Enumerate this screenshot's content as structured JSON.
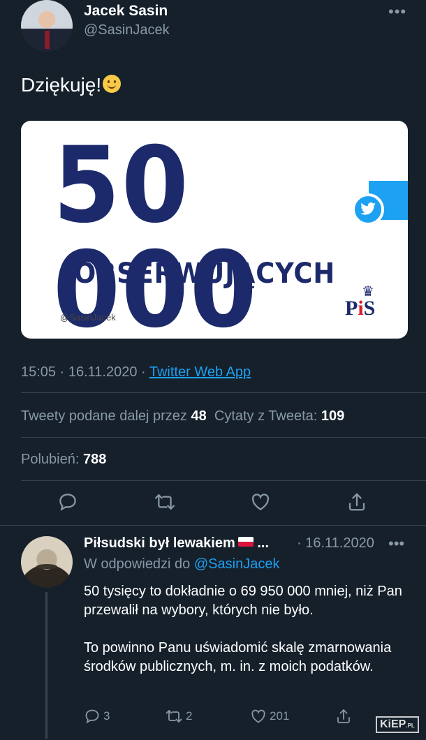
{
  "tweet": {
    "author_name": "Jacek Sasin",
    "author_handle": "@SasinJacek",
    "more_icon": "more-icon",
    "text": "Dziękuję!",
    "emoji": "slightly-smiling-face",
    "image": {
      "big_number": "50 000",
      "label": "OBSERWUJĄCYCH",
      "handle": "@SasinJacek",
      "logo_text_a": "P",
      "logo_text_b": "i",
      "logo_text_c": "S"
    },
    "time": "15:05 · 16.11.2020 ·",
    "client": "Twitter Web App",
    "stats": {
      "retweets_label": "Tweety podane dalej przez",
      "retweets": "48",
      "quotes_label": "Cytaty z Tweeta:",
      "quotes": "109",
      "likes_label": "Polubień:",
      "likes": "788"
    }
  },
  "reply": {
    "author_name": "Piłsudski był lewakiem",
    "ellipsis": "...",
    "date": "· 16.11.2020",
    "reply_to_label": "W odpowiedzi do",
    "reply_to_handle": "@SasinJacek",
    "paragraph1": "50 tysięcy to dokładnie o 69 950 000 mniej, niż Pan przewalił na wybory, których nie było.",
    "paragraph2": "To powinno Panu uświadomić skalę zmarnowania środków publicznych, m. in. z moich podatków.",
    "replies": "3",
    "retweets": "2",
    "likes": "201"
  },
  "watermark": {
    "text": "KiEP",
    "suffix": ".PL"
  },
  "colors": {
    "background": "#15202b",
    "muted": "#8899a6",
    "link": "#1da1f2",
    "divider": "#38444d",
    "number_blue": "#1c2a6b"
  }
}
